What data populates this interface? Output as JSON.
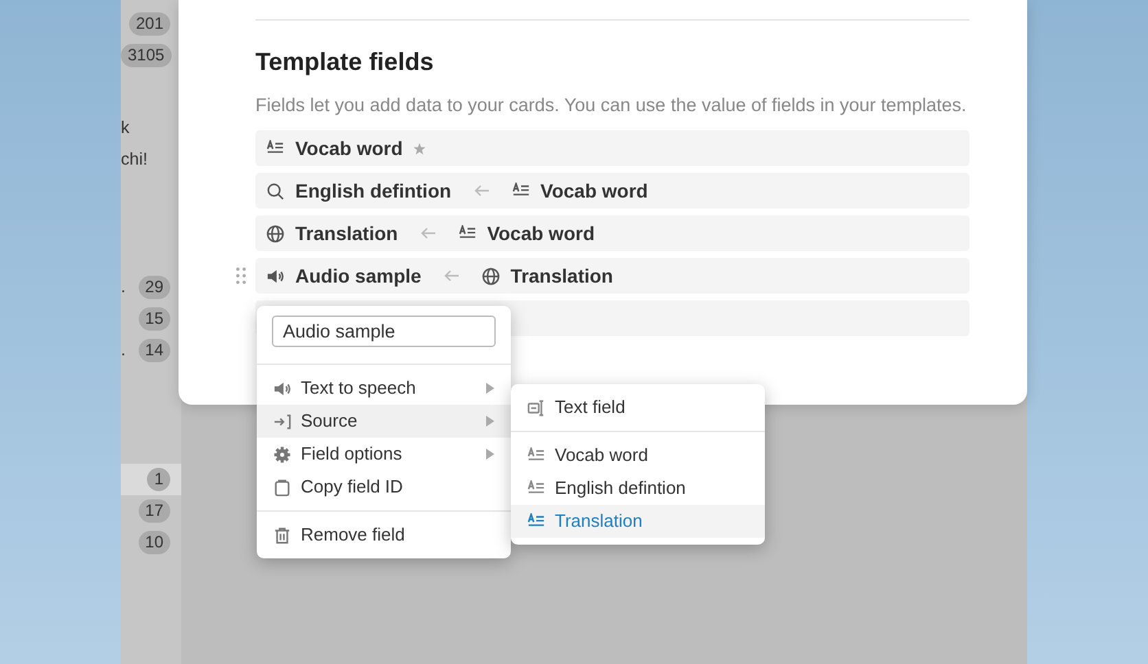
{
  "sidebar": {
    "groups": [
      {
        "items": [
          {
            "badge": "201",
            "selected": false
          },
          {
            "badge": "3105",
            "selected": false
          }
        ]
      },
      {
        "items": [
          {
            "text": "k",
            "selected": false
          },
          {
            "text": "chi!",
            "selected": false
          }
        ]
      },
      {
        "items": [
          {
            "text": ".",
            "badge": "29",
            "selected": false
          },
          {
            "badge": "15",
            "selected": false
          },
          {
            "text": ".",
            "badge": "14",
            "selected": false
          }
        ]
      },
      {
        "items": [
          {
            "badge": "1",
            "selected": true
          },
          {
            "badge": "17",
            "selected": false
          },
          {
            "badge": "10",
            "selected": false
          }
        ]
      }
    ]
  },
  "modal": {
    "title": "Template fields",
    "description": "Fields let you add data to your cards. You can use the value of fields in your templates.",
    "fields": [
      {
        "kind": "text",
        "name": "Vocab word",
        "primary": true,
        "hovered": false
      },
      {
        "kind": "search",
        "name": "English defintion",
        "primary": false,
        "hovered": false,
        "source": {
          "name": "Vocab word",
          "kind": "text"
        }
      },
      {
        "kind": "globe",
        "name": "Translation",
        "primary": false,
        "hovered": false,
        "source": {
          "name": "Vocab word",
          "kind": "text"
        }
      },
      {
        "kind": "speaker",
        "name": "Audio sample",
        "primary": false,
        "hovered": true,
        "source": {
          "name": "Translation",
          "kind": "globe"
        }
      },
      {
        "kind": "covered"
      }
    ]
  },
  "context_menu": {
    "name_value": "Audio sample",
    "groups": [
      [
        {
          "label": "Text to speech",
          "kind": "speaker",
          "submenu": true,
          "expanded": false
        },
        {
          "label": "Source",
          "kind": "source",
          "submenu": true,
          "expanded": true
        },
        {
          "label": "Field options",
          "kind": "gear",
          "submenu": true,
          "expanded": false
        },
        {
          "label": "Copy field ID",
          "kind": "clipboard",
          "submenu": false,
          "expanded": false
        }
      ],
      [
        {
          "label": "Remove field",
          "kind": "trash",
          "submenu": false,
          "expanded": false
        }
      ]
    ]
  },
  "source_menu": {
    "groups": [
      [
        {
          "label": "Text field",
          "kind": "textfield",
          "selected": false
        }
      ],
      [
        {
          "label": "Vocab word",
          "kind": "text",
          "selected": false
        },
        {
          "label": "English defintion",
          "kind": "text",
          "selected": false
        },
        {
          "label": "Translation",
          "kind": "text",
          "selected": true
        }
      ]
    ]
  }
}
